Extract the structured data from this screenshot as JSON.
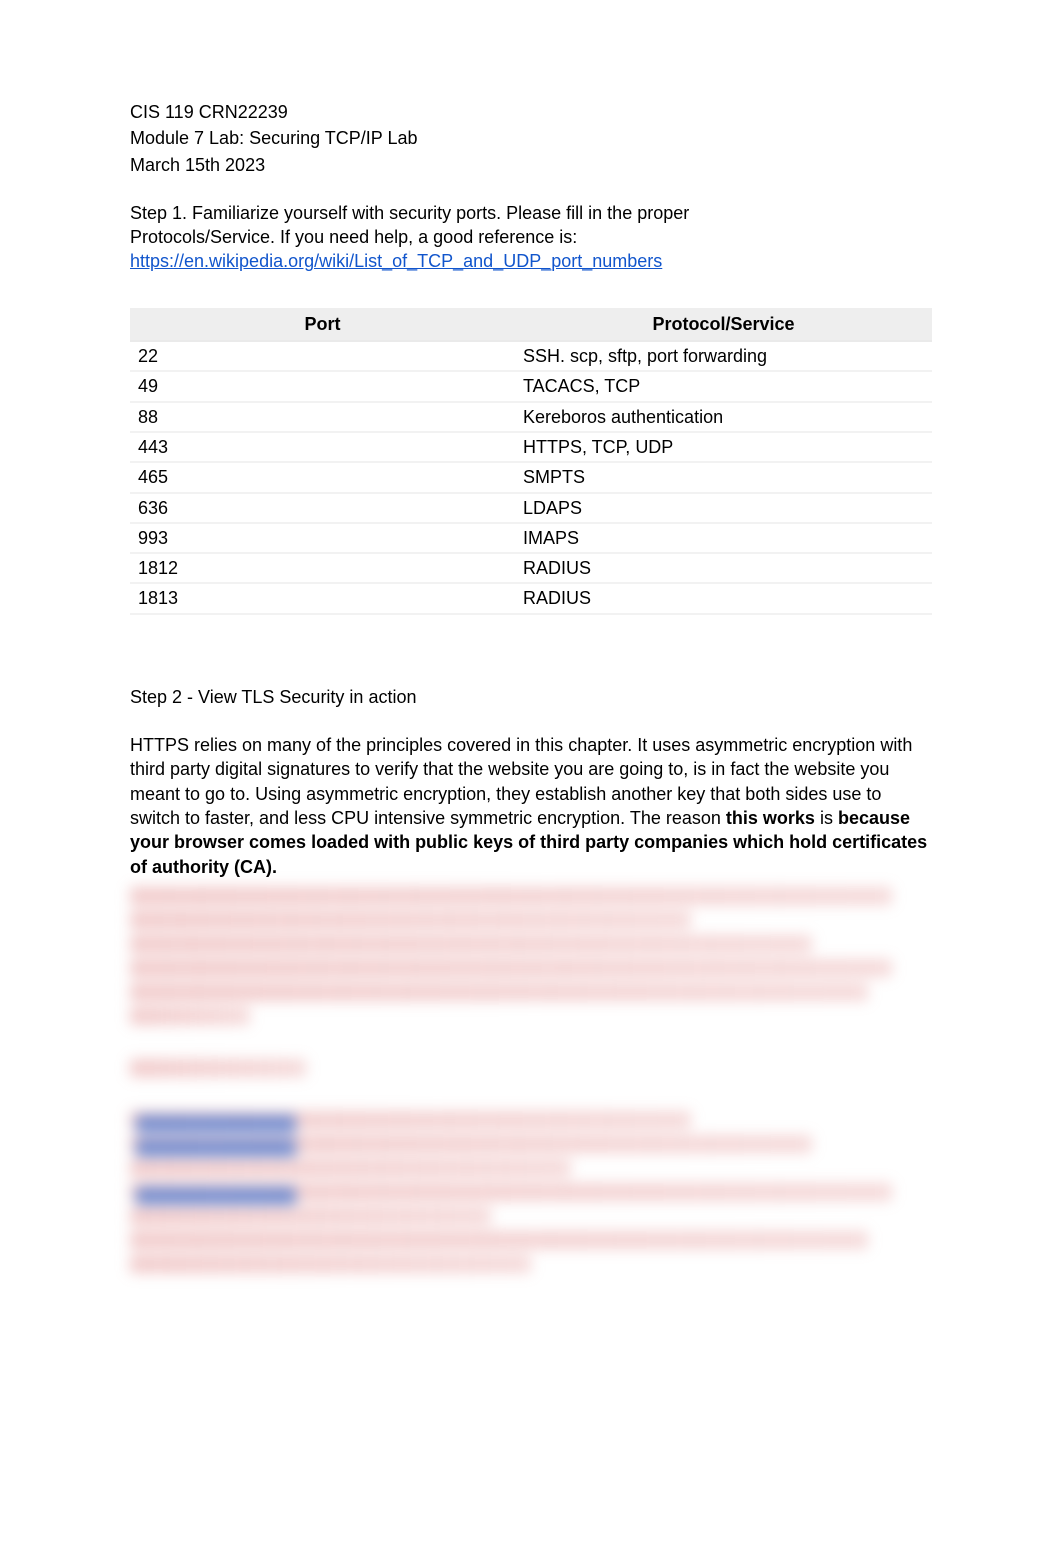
{
  "header": {
    "course": "CIS 119 CRN22239",
    "module": "Module 7 Lab: Securing TCP/IP Lab",
    "date": "March 15th 2023"
  },
  "step1": {
    "intro_line1": "Step 1. Familiarize yourself with security ports. Please fill in the proper",
    "intro_line2": "Protocols/Service. If you need help, a good reference is:",
    "link_text": "https://en.wikipedia.org/wiki/List_of_TCP_and_UDP_port_numbers"
  },
  "table": {
    "header_port": "Port",
    "header_protocol": "Protocol/Service",
    "rows": [
      {
        "port": "22",
        "protocol": "SSH. scp, sftp, port forwarding"
      },
      {
        "port": "49",
        "protocol": "TACACS, TCP"
      },
      {
        "port": "88",
        "protocol": "Kereboros authentication"
      },
      {
        "port": "443",
        "protocol": "HTTPS, TCP, UDP"
      },
      {
        "port": "465",
        "protocol": "SMPTS"
      },
      {
        "port": "636",
        "protocol": "LDAPS"
      },
      {
        "port": "993",
        "protocol": "IMAPS"
      },
      {
        "port": "1812",
        "protocol": "RADIUS"
      },
      {
        "port": "1813",
        "protocol": "RADIUS"
      }
    ]
  },
  "step2": {
    "title": "Step 2 - View TLS Security in action",
    "para_part1": "HTTPS relies on many of the principles covered in this chapter. It uses asymmetric encryption with third party digital signatures to verify that the website you are going to, is in fact the website you meant to go to. Using asymmetric encryption, they establish another key that both sides use to switch to faster, and less CPU intensive symmetric encryption. The reason ",
    "bold1": "this works",
    "mid": " is ",
    "bold2": "because your browser comes loaded with public keys of third party companies which hold certificates of authority (CA)."
  }
}
